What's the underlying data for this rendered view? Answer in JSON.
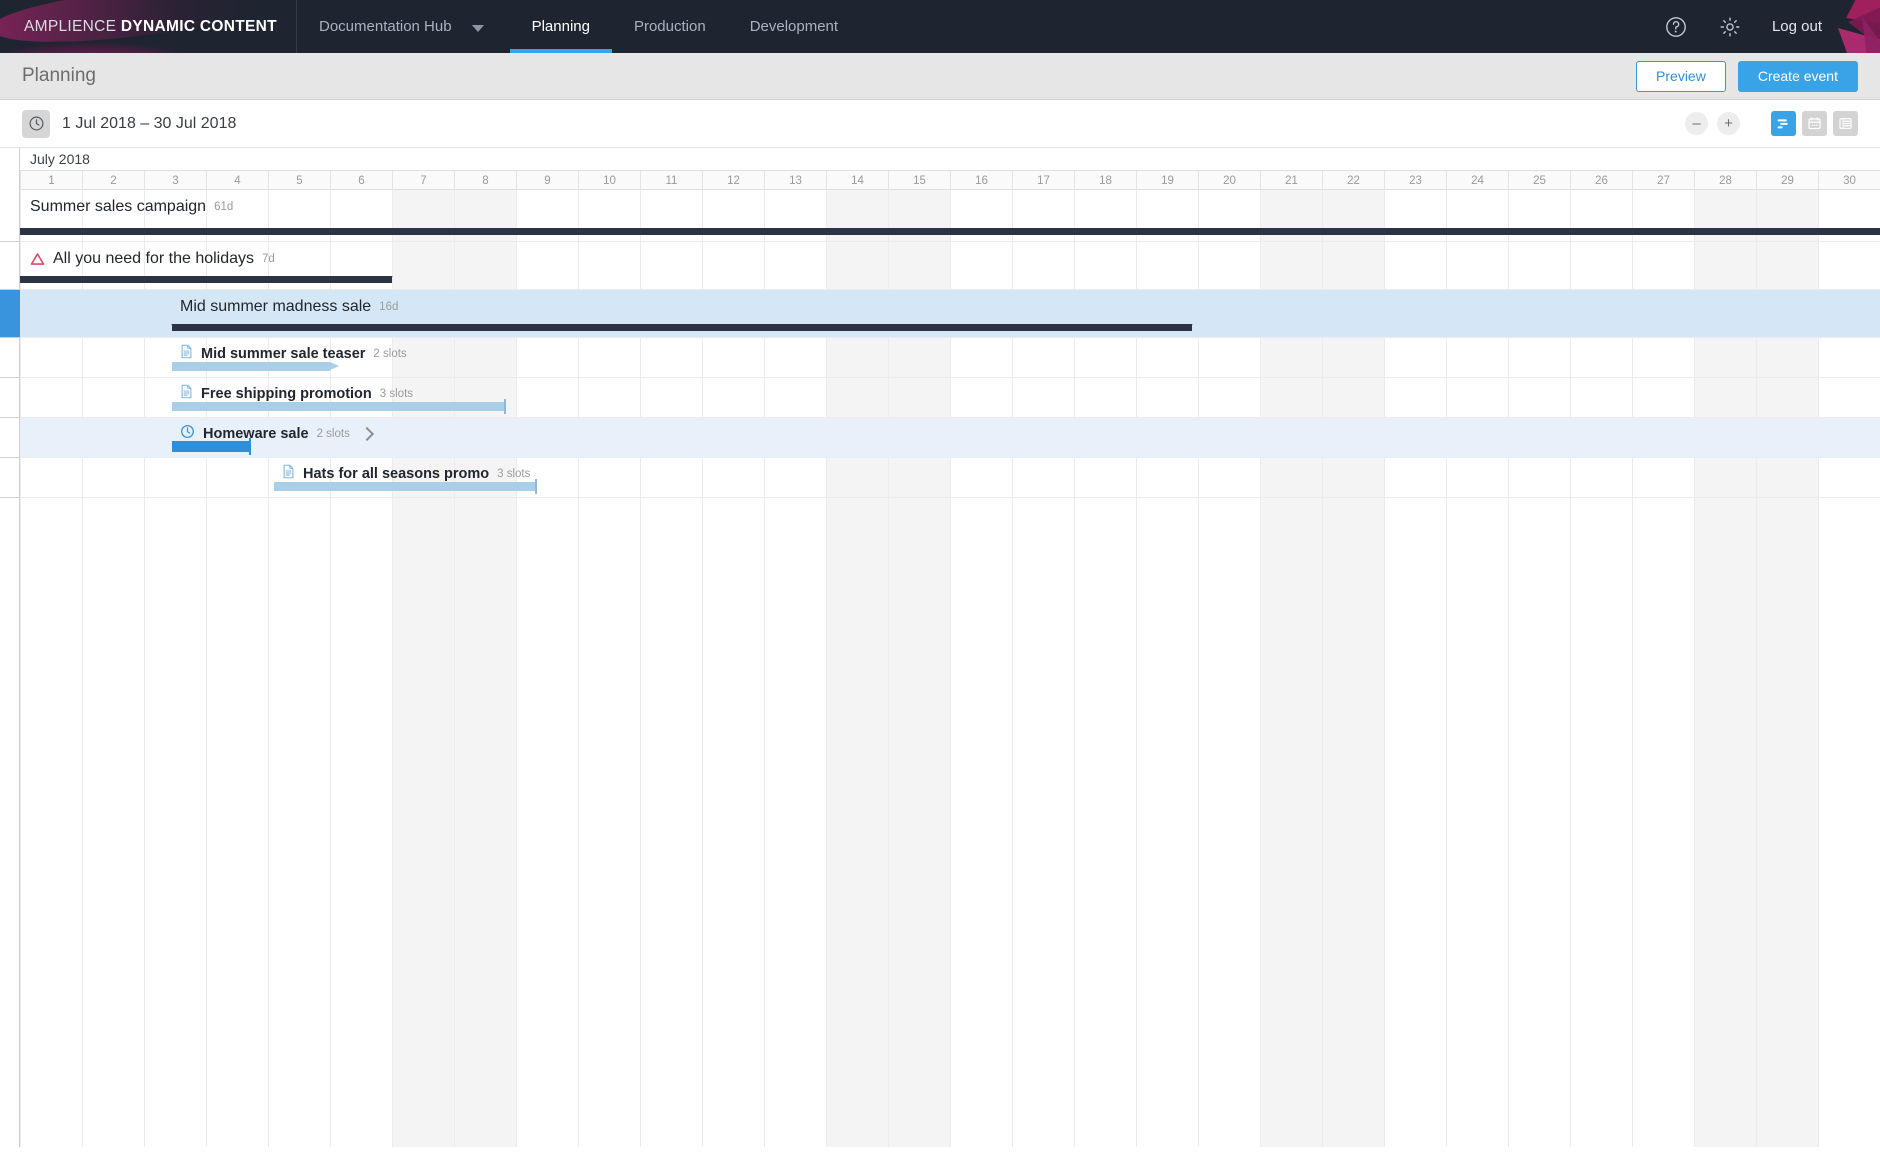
{
  "nav": {
    "brand_light": "AMPLIENCE ",
    "brand_bold": "DYNAMIC CONTENT",
    "hub_label": "Documentation Hub",
    "tabs": [
      {
        "label": "Planning",
        "active": true
      },
      {
        "label": "Production",
        "active": false
      },
      {
        "label": "Development",
        "active": false
      }
    ],
    "help_icon": "help-circle-icon",
    "settings_icon": "gear-icon",
    "logout_label": "Log out"
  },
  "page_header": {
    "title": "Planning",
    "preview_label": "Preview",
    "create_event_label": "Create event"
  },
  "toolbar": {
    "clock_icon": "clock-icon",
    "date_range": "1 Jul 2018 – 30 Jul 2018",
    "zoom_out_label": "–",
    "zoom_in_label": "+",
    "views": [
      {
        "name": "timeline-view",
        "icon": "gantt-icon",
        "active": true
      },
      {
        "name": "calendar-view",
        "icon": "calendar-icon",
        "active": false
      },
      {
        "name": "list-view",
        "icon": "list-icon",
        "active": false
      }
    ]
  },
  "timeline": {
    "month_label": "July 2018",
    "days": [
      1,
      2,
      3,
      4,
      5,
      6,
      7,
      8,
      9,
      10,
      11,
      12,
      13,
      14,
      15,
      16,
      17,
      18,
      19,
      20,
      21,
      22,
      23,
      24,
      25,
      26,
      27,
      28,
      29,
      30
    ],
    "weekend_days": [
      7,
      8,
      14,
      15,
      21,
      22,
      28,
      29
    ],
    "accent_blue": "#39a3e8",
    "bar_dark": "#2b3344",
    "bar_light": "#a9cfe8",
    "bar_blue": "#2e8fd8",
    "warn_red": "#e04a6b"
  },
  "rows": [
    {
      "id": "summer-sales-campaign",
      "title": "Summer sales campaign",
      "meta": "61d",
      "icon": null,
      "bar_kind": "dark",
      "bar_start_day": 1,
      "bar_end_day": 31,
      "cap_left": false,
      "cap_right": false,
      "highlight": "none",
      "indent": 0,
      "expander": false
    },
    {
      "id": "all-you-need-for-the-holidays",
      "title": "All you need for the holidays",
      "meta": "7d",
      "icon": "warning-triangle-icon",
      "bar_kind": "dark",
      "bar_start_day": 1,
      "bar_end_day": 7,
      "cap_left": false,
      "cap_right": true,
      "highlight": "none",
      "indent": 0,
      "expander": false
    },
    {
      "id": "mid-summer-madness-sale",
      "title": "Mid summer madness sale",
      "meta": "16d",
      "icon": null,
      "bar_kind": "dark",
      "bar_start_day": 3.45,
      "bar_end_day": 19.9,
      "cap_left": true,
      "cap_right": true,
      "highlight": "strong",
      "indent": 1,
      "expander": false,
      "selected": true
    },
    {
      "id": "mid-summer-sale-teaser",
      "title": "Mid summer sale teaser",
      "meta": "2 slots",
      "icon": "document-icon",
      "bar_kind": "light-arrow",
      "bar_start_day": 3.45,
      "bar_end_day": 6,
      "highlight": "none",
      "indent": 2,
      "expander": false
    },
    {
      "id": "free-shipping-promotion",
      "title": "Free shipping promotion",
      "meta": "3 slots",
      "icon": "document-icon",
      "bar_kind": "light-tick",
      "bar_start_day": 3.45,
      "bar_end_day": 8.8,
      "highlight": "none",
      "indent": 2,
      "expander": false
    },
    {
      "id": "homeware-sale",
      "title": "Homeware sale",
      "meta": "2 slots",
      "icon": "clock-icon-blue",
      "bar_kind": "blue-tick",
      "bar_start_day": 3.45,
      "bar_end_day": 4.7,
      "highlight": "soft",
      "indent": 2,
      "expander": true
    },
    {
      "id": "hats-for-all-seasons-promo",
      "title": "Hats for all seasons promo",
      "meta": "3 slots",
      "icon": "document-icon",
      "bar_kind": "light-tick",
      "bar_start_day": 5.1,
      "bar_end_day": 9.3,
      "highlight": "none",
      "indent": 3,
      "expander": false
    }
  ]
}
